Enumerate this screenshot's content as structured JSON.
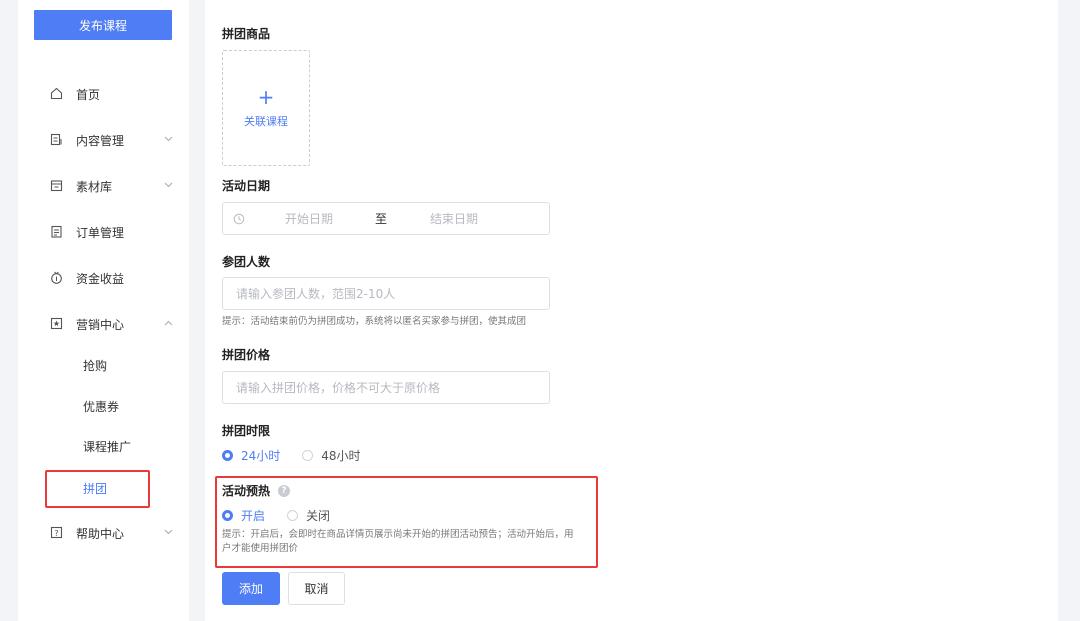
{
  "sidebar": {
    "publish_label": "发布课程",
    "items": [
      {
        "label": "首页",
        "icon": "home-icon"
      },
      {
        "label": "内容管理",
        "icon": "content-icon"
      },
      {
        "label": "素材库",
        "icon": "folder-icon"
      },
      {
        "label": "订单管理",
        "icon": "order-icon"
      },
      {
        "label": "资金收益",
        "icon": "money-icon"
      },
      {
        "label": "营销中心",
        "icon": "marketing-icon"
      },
      {
        "label": "帮助中心",
        "icon": "help-icon"
      }
    ],
    "marketing_sub": [
      "抢购",
      "优惠券",
      "课程推广",
      "拼团"
    ],
    "active_sub": "拼团"
  },
  "form": {
    "product_label": "拼团商品",
    "link_course": "关联课程",
    "date_label": "活动日期",
    "date_start": "开始日期",
    "date_sep": "至",
    "date_end": "结束日期",
    "people_label": "参团人数",
    "people_placeholder": "请输入参团人数，范围2-10人",
    "people_hint": "提示：活动结束前仍为拼团成功，系统将以匿名买家参与拼团，使其成团",
    "price_label": "拼团价格",
    "price_placeholder": "请输入拼团价格，价格不可大于原价格",
    "time_label": "拼团时限",
    "time_options": [
      "24小时",
      "48小时"
    ],
    "time_selected": "24小时",
    "preheat_label": "活动预热",
    "preheat_options": [
      "开启",
      "关闭"
    ],
    "preheat_selected": "开启",
    "preheat_hint_1": "提示：开启后，会即时在商品详情页展示尚未开始的拼团活动预告；活动开始后，用",
    "preheat_hint_2": "户才能使用拼团价",
    "add_button": "添加",
    "cancel_button": "取消"
  },
  "colors": {
    "accent": "#4f7df5",
    "highlight": "#e83a3a"
  }
}
